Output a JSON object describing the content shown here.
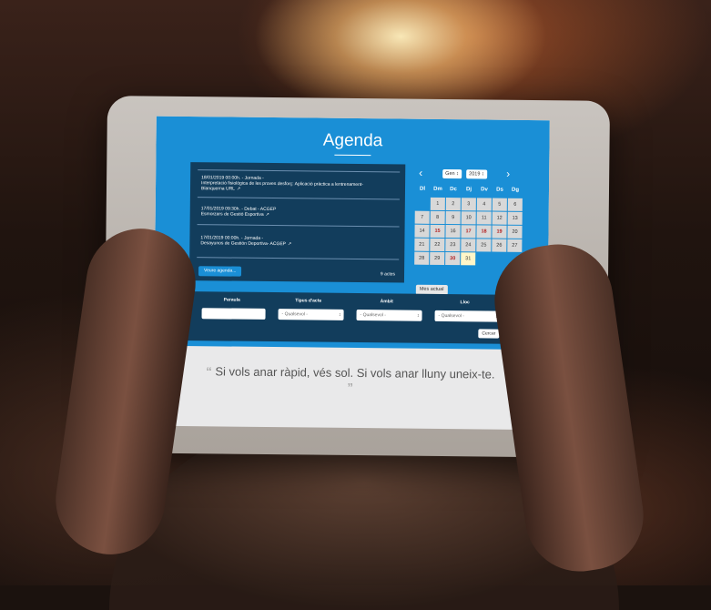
{
  "agenda": {
    "title": "Agenda",
    "events": [
      {
        "line1": "18/01/2019 00:00h. - Jornada -",
        "line2": "Interpretació fisiològica de les proves desforç: Aplicació pràctica a lentrenament-",
        "line3": "Blanquerna URL"
      },
      {
        "line1": "17/01/2019 09:30h. - Debat - ACGEP",
        "line2": "Esmorzars de Gestió Esportiva",
        "line3": ""
      },
      {
        "line1": "17/01/2019 00:00h. - Jornada -",
        "line2": "Desayunos de Gestión Deportiva- ACGEP",
        "line3": ""
      }
    ],
    "veure_label": "Veure agenda...",
    "count_label": "9 actes"
  },
  "calendar": {
    "month": "Gen",
    "year": "2019",
    "prev_icon": "chevron-left-icon",
    "next_icon": "chevron-right-icon",
    "days_of_week": [
      "Dl",
      "Dm",
      "Dc",
      "Dj",
      "Dv",
      "Ds",
      "Dg"
    ],
    "weeks": [
      [
        "",
        "1",
        "2",
        "3",
        "4",
        "5",
        "6"
      ],
      [
        "7",
        "8",
        "9",
        "10",
        "11",
        "12",
        "13"
      ],
      [
        "14",
        "15",
        "16",
        "17",
        "18",
        "19",
        "20"
      ],
      [
        "21",
        "22",
        "23",
        "24",
        "25",
        "26",
        "27"
      ],
      [
        "28",
        "29",
        "30",
        "31",
        "",
        "",
        ""
      ]
    ],
    "highlighted_days": [
      "15",
      "17",
      "18",
      "19",
      "30"
    ],
    "today": "31",
    "mes_actual_label": "Mes actual"
  },
  "filters": {
    "paraula_label": "Paraula",
    "paraula_value": "",
    "tipus_label": "Tipus d'acte",
    "ambit_label": "Àmbit",
    "lloc_label": "Lloc",
    "select_default": "- Qualsevol -",
    "cercar_label": "Cercar"
  },
  "quote": {
    "text": "Si vols anar ràpid, vés sol. Si vols anar lluny uneix-te."
  },
  "colors": {
    "primary_blue": "#1a8fd6",
    "panel_dark": "#123d5c",
    "highlight_red": "#b32020",
    "today_yellow": "#fff6c8"
  }
}
